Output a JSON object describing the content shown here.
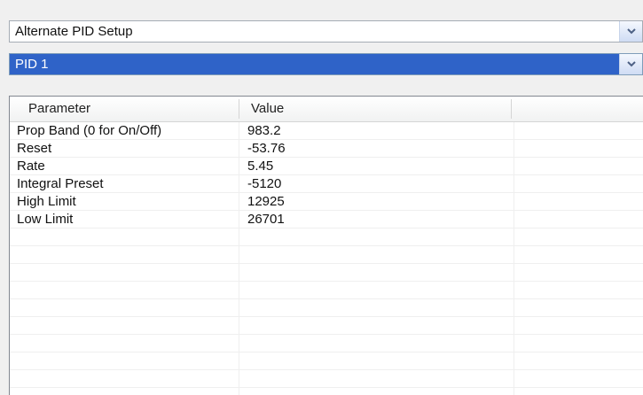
{
  "combos": {
    "setup": {
      "value": "Alternate PID Setup",
      "arrow_icon": "chevron-down-icon"
    },
    "pid": {
      "value": "PID 1",
      "arrow_icon": "chevron-down-icon",
      "highlight": "#2f63c8"
    }
  },
  "table": {
    "columns": [
      "Parameter",
      "Value",
      ""
    ],
    "rows": [
      {
        "parameter": "Prop Band (0 for On/Off)",
        "value": "983.2"
      },
      {
        "parameter": "Reset",
        "value": "-53.76"
      },
      {
        "parameter": "Rate",
        "value": "5.45"
      },
      {
        "parameter": "Integral Preset",
        "value": "-5120"
      },
      {
        "parameter": "High Limit",
        "value": "12925"
      },
      {
        "parameter": "Low Limit",
        "value": "26701"
      },
      {
        "parameter": "",
        "value": ""
      },
      {
        "parameter": "",
        "value": ""
      },
      {
        "parameter": "",
        "value": ""
      },
      {
        "parameter": "",
        "value": ""
      },
      {
        "parameter": "",
        "value": ""
      },
      {
        "parameter": "",
        "value": ""
      },
      {
        "parameter": "",
        "value": ""
      },
      {
        "parameter": "",
        "value": ""
      },
      {
        "parameter": "",
        "value": ""
      },
      {
        "parameter": "",
        "value": ""
      }
    ]
  }
}
